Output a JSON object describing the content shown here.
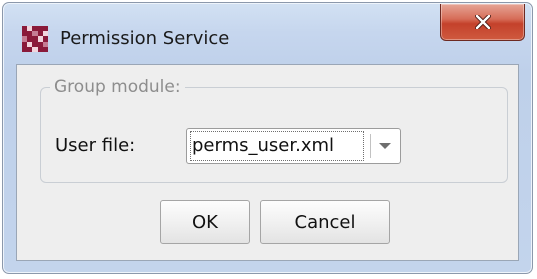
{
  "window": {
    "title": "Permission Service",
    "close_icon": "close-icon",
    "app_icon": "app-logo-icon"
  },
  "group": {
    "legend": "Group module:",
    "user_file_label": "User file:",
    "user_file_value": "perms_user.xml",
    "dropdown_icon": "chevron-down-icon"
  },
  "buttons": {
    "ok": "OK",
    "cancel": "Cancel"
  },
  "colors": {
    "title_bar": "#c6d6ee",
    "close_button": "#c4412b",
    "client_background": "#eeeeee",
    "legend_text": "#8d8d8d",
    "app_icon_dark": "#8a1a3a",
    "app_icon_light": "#f1d5dd"
  }
}
